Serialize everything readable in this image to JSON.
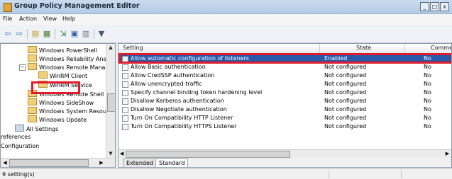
{
  "window": {
    "title": "Group Policy Management Editor",
    "minimize": "_",
    "maximize": "□",
    "close": "x"
  },
  "menu": [
    {
      "label": "File"
    },
    {
      "label": "Action"
    },
    {
      "label": "View"
    },
    {
      "label": "Help"
    }
  ],
  "toolbar": {
    "icons": [
      "back-arrow-icon",
      "forward-arrow-icon",
      "up-folder-icon",
      "show-hide-tree-icon",
      "export-list-icon",
      "help-icon",
      "properties-icon",
      "filter-icon"
    ]
  },
  "tree": [
    {
      "label": "Windows PowerShell"
    },
    {
      "label": "Windows Reliability Analy"
    },
    {
      "label": "Windows Remote Manage"
    },
    {
      "label": "WinRM Client"
    },
    {
      "label": "WinRM Service"
    },
    {
      "label": "Windows Remote Shell"
    },
    {
      "label": "Windows SideShow"
    },
    {
      "label": "Windows System Resourc"
    },
    {
      "label": "Windows Update"
    },
    {
      "label": "All Settings"
    },
    {
      "label": "references"
    },
    {
      "label": "Configuration"
    }
  ],
  "list": {
    "columns": {
      "setting": "Setting",
      "state": "State",
      "comment": "Comment"
    },
    "rows": [
      {
        "name": "Allow automatic configuration of listeners",
        "state": "Enabled",
        "comment": "No"
      },
      {
        "name": "Allow Basic authentication",
        "state": "Not configured",
        "comment": "No"
      },
      {
        "name": "Allow CredSSP authentication",
        "state": "Not configured",
        "comment": "No"
      },
      {
        "name": "Allow unencrypted traffic",
        "state": "Not configured",
        "comment": "No"
      },
      {
        "name": "Specify channel binding token hardening level",
        "state": "Not configured",
        "comment": "No"
      },
      {
        "name": "Disallow Kerberos authentication",
        "state": "Not configured",
        "comment": "No"
      },
      {
        "name": "Disallow Negotiate authentication",
        "state": "Not configured",
        "comment": "No"
      },
      {
        "name": "Turn On Compatibility HTTP Listener",
        "state": "Not configured",
        "comment": "No"
      },
      {
        "name": "Turn On Compatibility HTTPS Listener",
        "state": "Not configured",
        "comment": "No"
      }
    ]
  },
  "tabs": [
    {
      "label": "Extended"
    },
    {
      "label": "Standard"
    }
  ],
  "status": {
    "text": "9 setting(s)"
  },
  "colors": {
    "highlight": "#e01b2a",
    "selection": "#2a58a8"
  }
}
